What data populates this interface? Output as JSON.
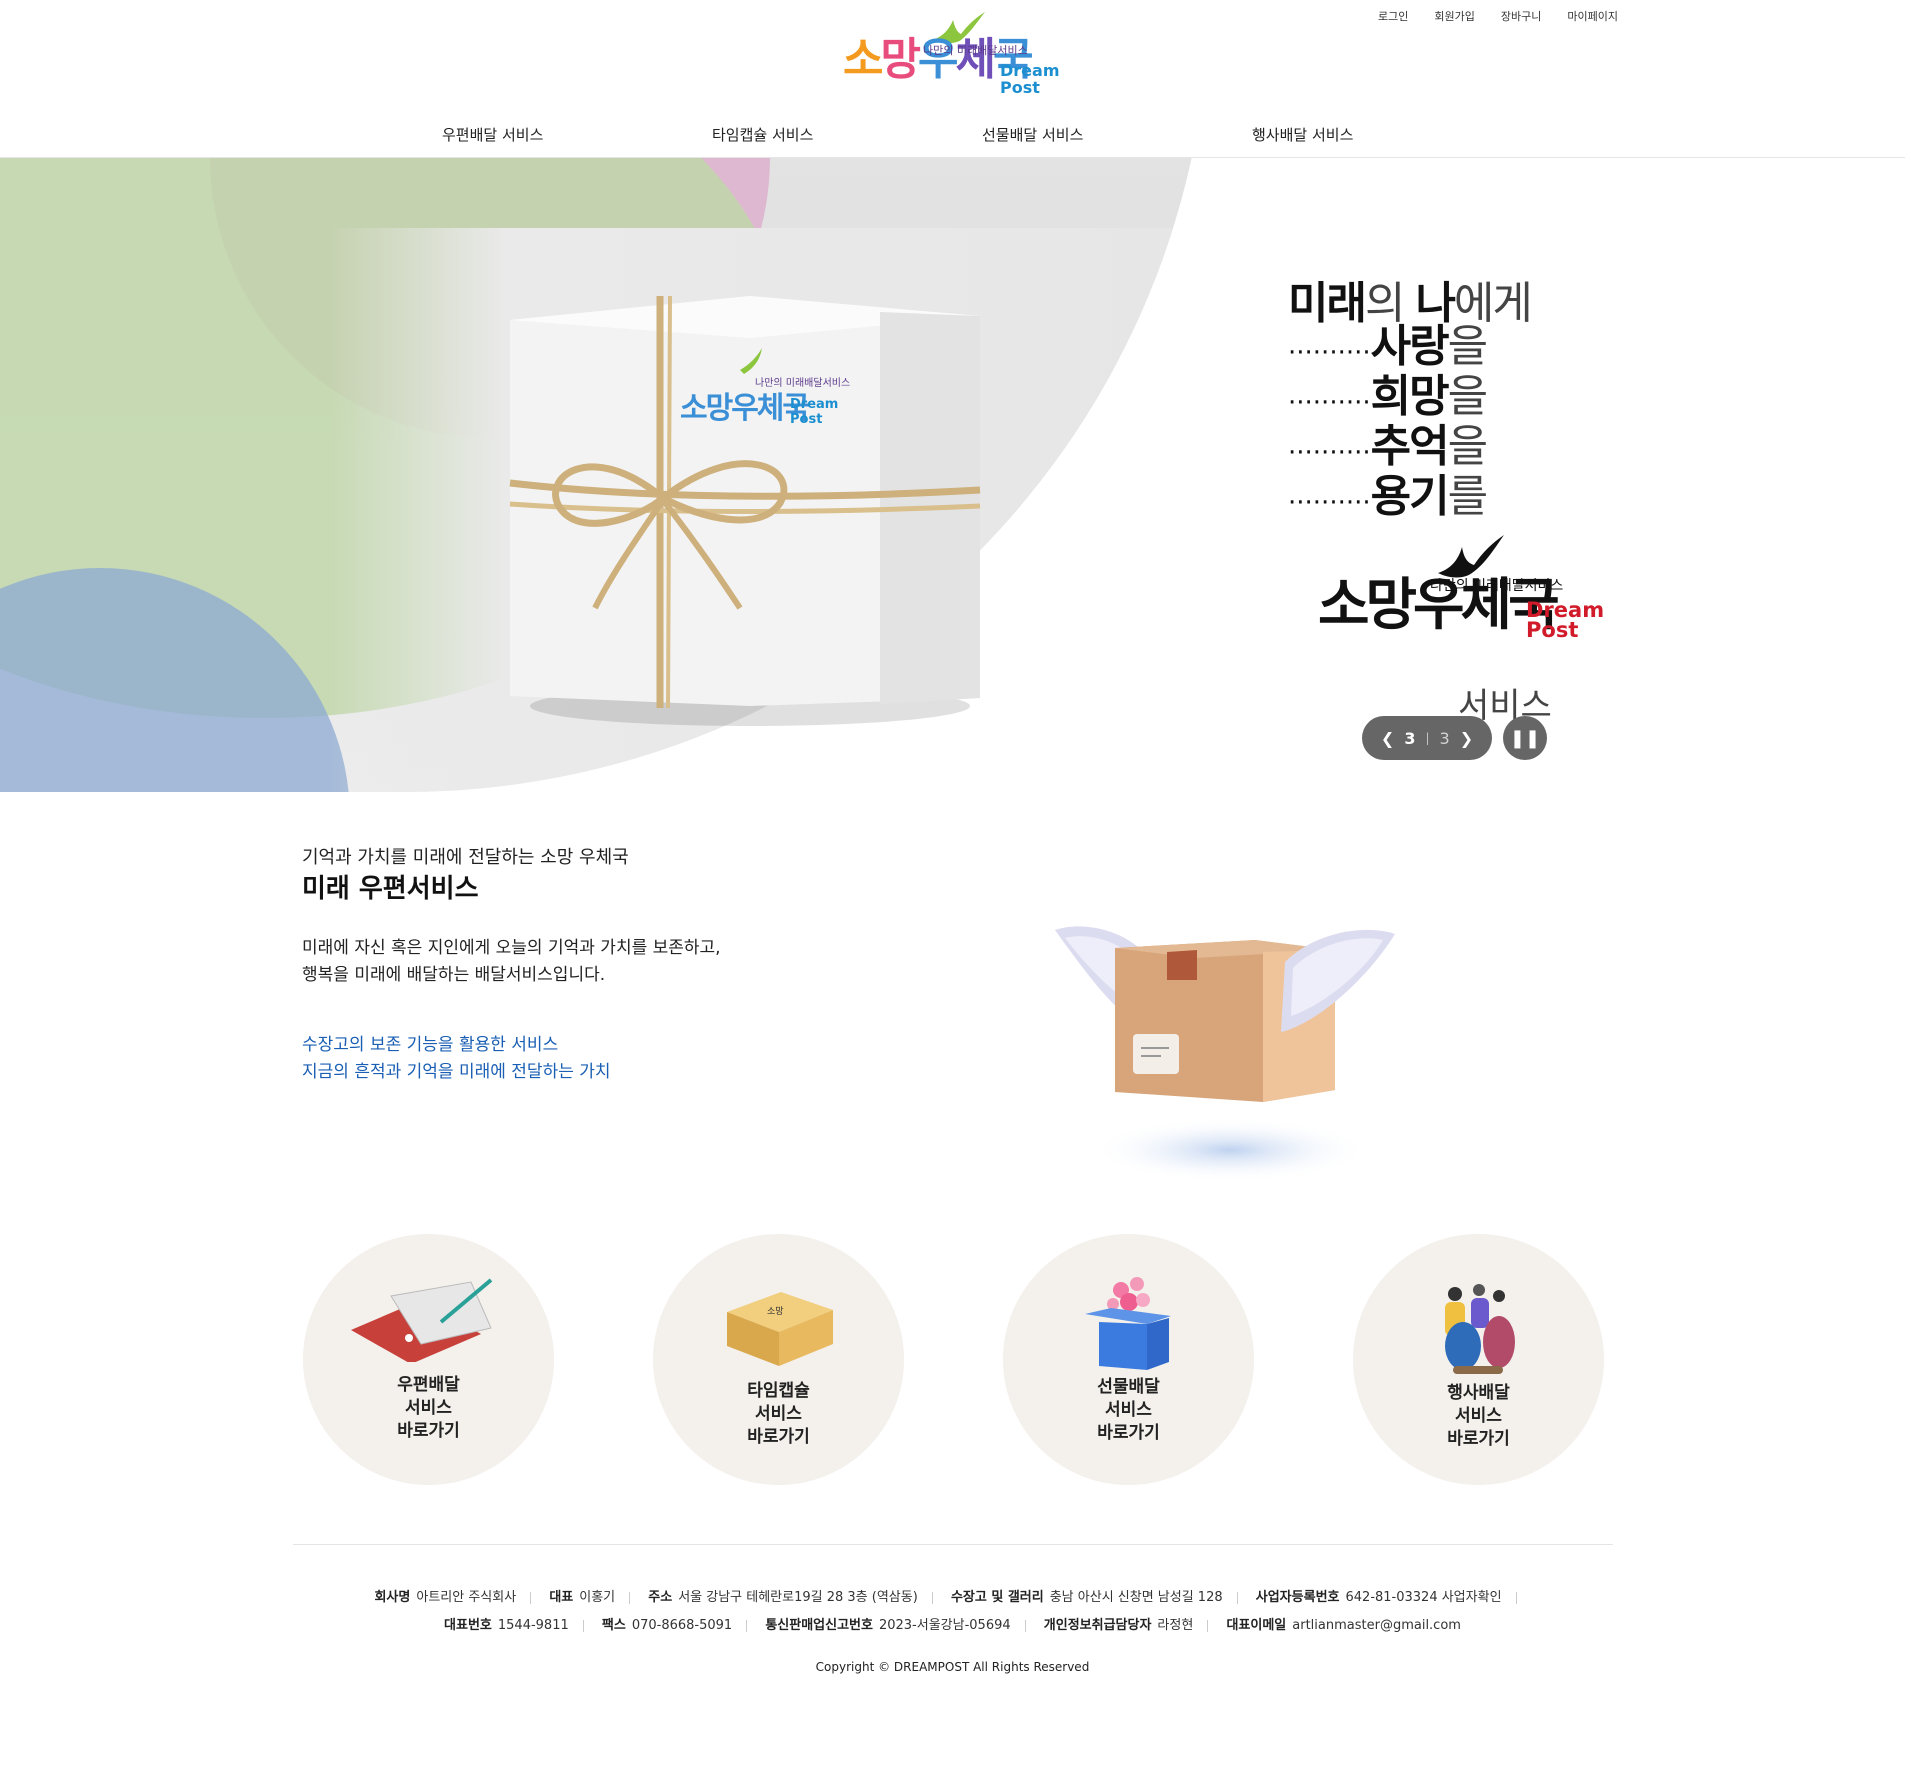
{
  "header": {
    "util_links": [
      "로그인",
      "회원가입",
      "장바구니",
      "마이페이지"
    ],
    "logo": {
      "main": "소망우체국",
      "sub": "나만의 미래배달서비스",
      "en_line1": "Dream",
      "en_line2": "Post"
    },
    "nav": [
      "우편배달 서비스",
      "타임캡슐 서비스",
      "선물배달 서비스",
      "행사배달 서비스"
    ]
  },
  "hero": {
    "lines": [
      {
        "dots": "",
        "bold": "미래",
        "light": "의 ",
        "bold2": "나",
        "light2": "에게"
      },
      {
        "dots": "··········",
        "bold": "사랑",
        "light": "을"
      },
      {
        "dots": "··········",
        "bold": "희망",
        "light": "을"
      },
      {
        "dots": "··········",
        "bold": "추억",
        "light": "을"
      },
      {
        "dots": "··········",
        "bold": "용기",
        "light": "를"
      }
    ],
    "logo_main": "소망우체국",
    "logo_sub": "나만의 미래배달서비스",
    "logo_en1": "Dream",
    "logo_en2": "Post",
    "service_word": "서비스",
    "slider": {
      "current": "3",
      "divider": "|",
      "total": "3",
      "prev_icon": "chevron-left-icon",
      "next_icon": "chevron-right-icon",
      "pause_icon": "pause-icon"
    }
  },
  "intro": {
    "subtitle": "기억과 가치를 미래에 전달하는 소망 우체국",
    "title": "미래 우편서비스",
    "desc1": "미래에 자신 혹은 지인에게 오늘의 기억과 가치를 보존하고,",
    "desc2": "행복을 미래에 배달하는 배달서비스입니다.",
    "hl1": "수장고의 보존 기능을 활용한 서비스",
    "hl2": "지금의 흔적과 기억을 미래에 전달하는 가치"
  },
  "services": [
    {
      "l1": "우편배달",
      "l2": "서비스",
      "l3": "바로가기"
    },
    {
      "l1": "타임캡슐",
      "l2": "서비스",
      "l3": "바로가기"
    },
    {
      "l1": "선물배달",
      "l2": "서비스",
      "l3": "바로가기"
    },
    {
      "l1": "행사배달",
      "l2": "서비스",
      "l3": "바로가기"
    }
  ],
  "footer": {
    "row1": [
      {
        "k": "회사명",
        "v": "아트리안 주식회사"
      },
      {
        "k": "대표",
        "v": "이홍기"
      },
      {
        "k": "주소",
        "v": "서울 강남구 테헤란로19길 28 3층 (역삼동)"
      },
      {
        "k": "수장고 및 갤러리",
        "v": "충남 아산시 신창면 남성길 128"
      },
      {
        "k": "사업자등록번호",
        "v": "642-81-03324 사업자확인"
      }
    ],
    "row2": [
      {
        "k": "대표번호",
        "v": "1544-9811"
      },
      {
        "k": "팩스",
        "v": "070-8668-5091"
      },
      {
        "k": "통신판매업신고번호",
        "v": "2023-서울강남-05694"
      },
      {
        "k": "개인정보취급담당자",
        "v": "라정현"
      },
      {
        "k": "대표이메일",
        "v": "artlianmaster@gmail.com"
      }
    ],
    "copyright": "Copyright © DREAMPOST All Rights Reserved"
  },
  "colors": {
    "accent_blue": "#1a5fb4",
    "circle_bg": "#f4f0ec",
    "control_bg": "#666666"
  }
}
